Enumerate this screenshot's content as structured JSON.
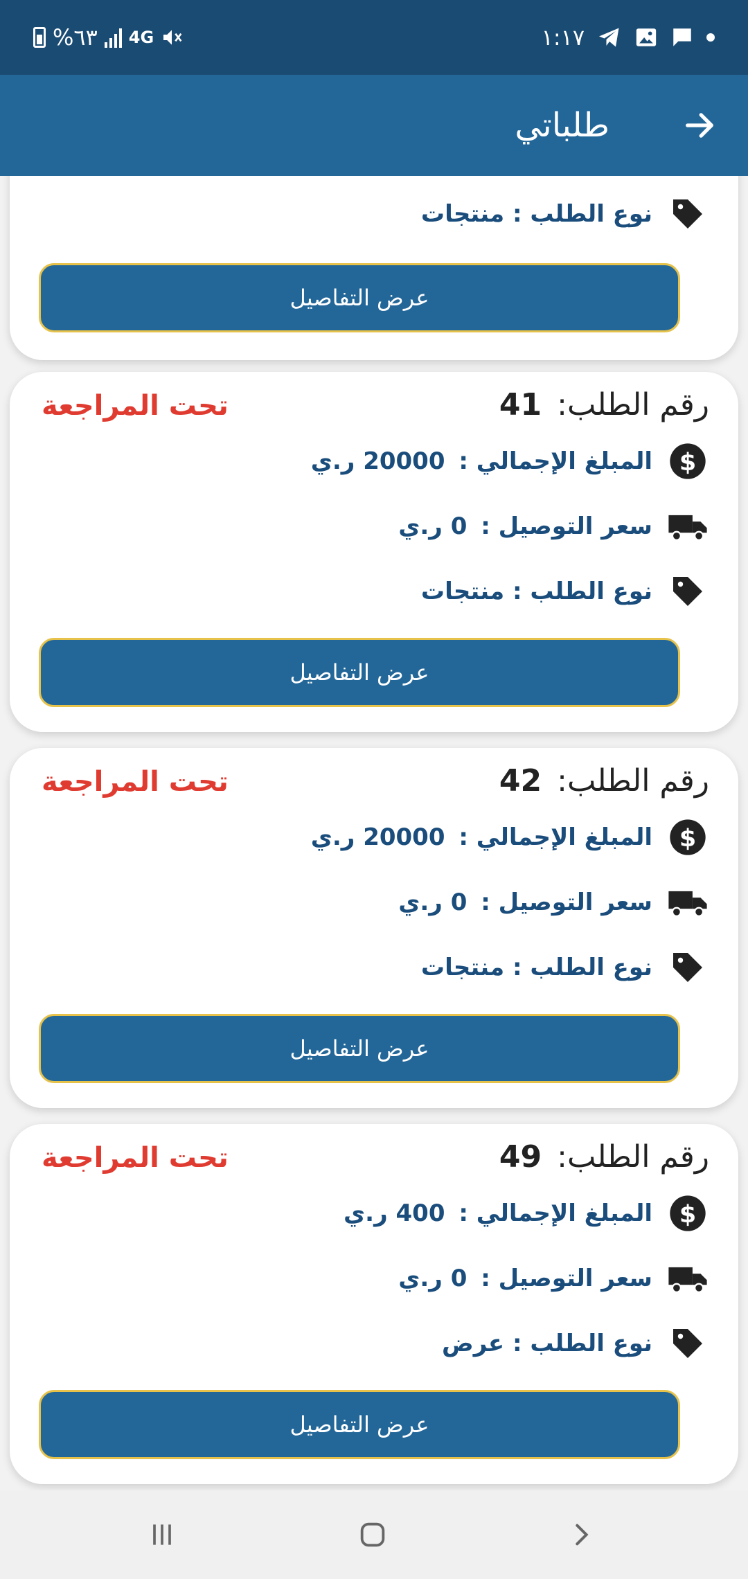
{
  "status_bar": {
    "time": "١:١٧",
    "battery": "%٦٣",
    "network": "4G"
  },
  "app_bar": {
    "title": "طلباتي"
  },
  "labels": {
    "order_number": "رقم الطلب:",
    "total_amount": "المبلغ الإجمالي :",
    "delivery_price": "سعر التوصيل :",
    "order_type": "نوع الطلب :",
    "currency": "ر.ي",
    "details_button": "عرض التفاصيل"
  },
  "first_card": {
    "order_type": "منتجات"
  },
  "orders": [
    {
      "number": "41",
      "status": "تحت المراجعة",
      "total": "20000",
      "delivery": "0",
      "type": "منتجات"
    },
    {
      "number": "42",
      "status": "تحت المراجعة",
      "total": "20000",
      "delivery": "0",
      "type": "منتجات"
    },
    {
      "number": "49",
      "status": "تحت المراجعة",
      "total": "400",
      "delivery": "0",
      "type": "عرض"
    }
  ],
  "colors": {
    "status_bar": "#1a4b73",
    "app_bar": "#236799",
    "button": "#236799",
    "button_border": "#e6c24a",
    "status_text": "#e03b30",
    "value_text": "#1a4d7c"
  }
}
